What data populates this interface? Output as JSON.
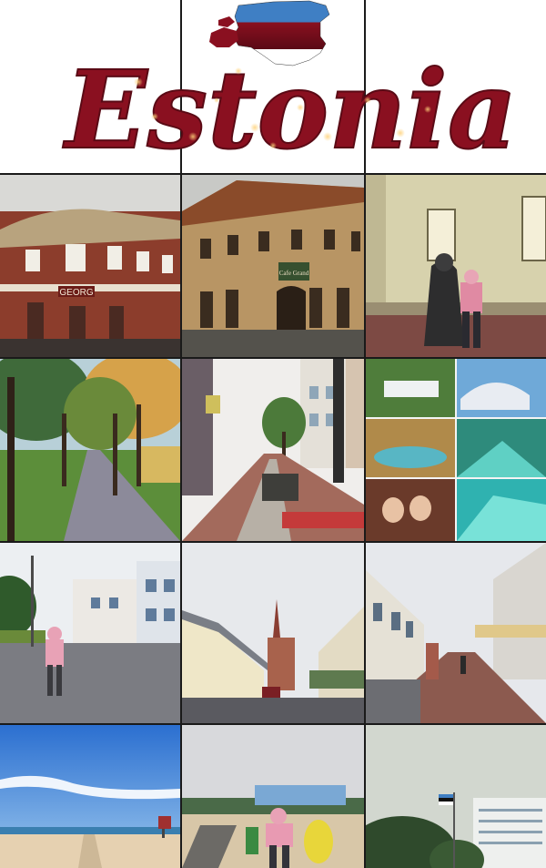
{
  "title": "Estonia",
  "colors": {
    "title_fill": "#8a1020",
    "title_glow": "#f6a13a",
    "flag_blue": "#3f7fc4",
    "flag_black": "#111111",
    "flag_white": "#ffffff"
  },
  "sign_georg": "GEORG",
  "sign_cafe": "Cafe Grand",
  "tiles": [
    {
      "id": "hotel-georg",
      "icon": "building-photo"
    },
    {
      "id": "cafe-grand",
      "icon": "building-photo"
    },
    {
      "id": "statue-woman",
      "icon": "statue-photo"
    },
    {
      "id": "park-alley",
      "icon": "park-photo"
    },
    {
      "id": "pedestrian-street",
      "icon": "street-photo"
    },
    {
      "id": "spa-collage",
      "icon": "spa-photo"
    },
    {
      "id": "square-woman",
      "icon": "street-photo"
    },
    {
      "id": "church-street",
      "icon": "church-photo"
    },
    {
      "id": "brick-street",
      "icon": "street-photo"
    },
    {
      "id": "beach",
      "icon": "beach-photo"
    },
    {
      "id": "beach-woman",
      "icon": "beach-photo"
    },
    {
      "id": "flag-hotel",
      "icon": "flag-photo"
    }
  ]
}
